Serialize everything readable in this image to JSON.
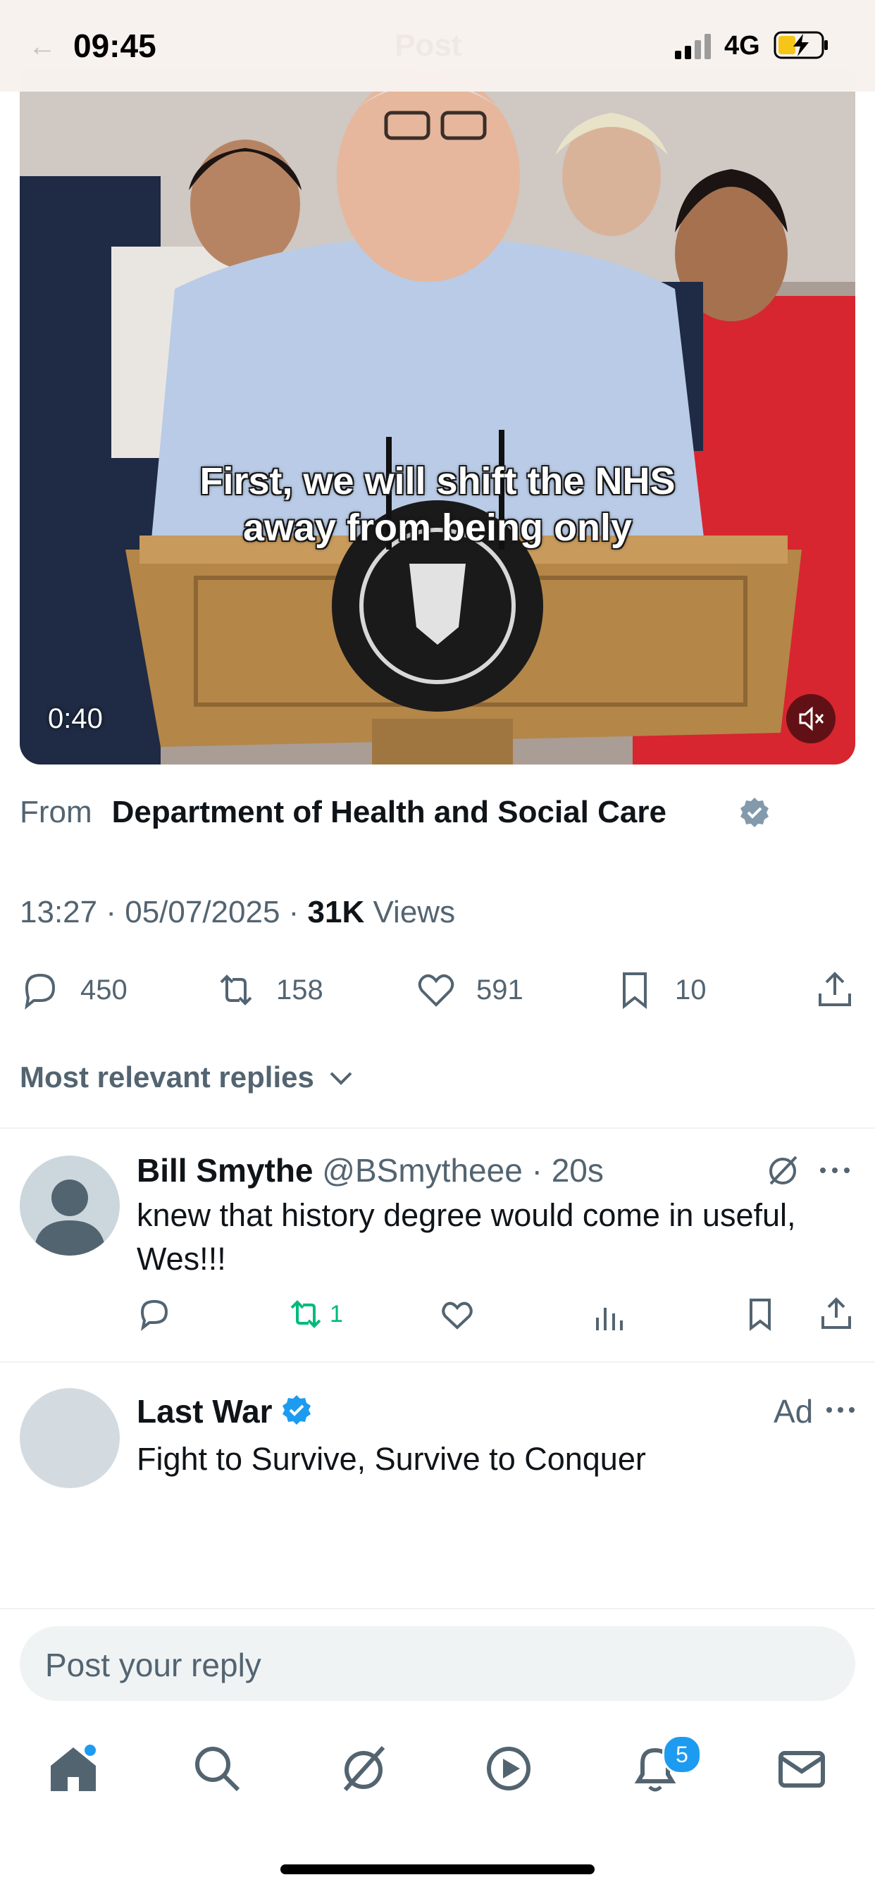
{
  "status_bar": {
    "time": "09:45",
    "network": "4G"
  },
  "header": {
    "title": "Post"
  },
  "video": {
    "caption_line1": "First, we will shift the NHS",
    "caption_line2": "away from being only",
    "duration": "0:40"
  },
  "post": {
    "from_label": "From",
    "from_name": "Department of Health and Social Care",
    "time": "13:27",
    "date": "05/07/2025",
    "views_count": "31K",
    "views_label": "Views",
    "replies": "450",
    "reposts": "158",
    "likes": "591",
    "bookmarks": "10"
  },
  "replies_filter": {
    "label": "Most relevant replies"
  },
  "replies": [
    {
      "name": "Bill Smythe",
      "handle": "@BSmytheee",
      "age": "20s",
      "text_line1": "knew that history degree would come in useful,",
      "text_line2": "Wes!!!",
      "reposts": "1"
    }
  ],
  "ad": {
    "name": "Last War",
    "label": "Ad",
    "text": "Fight to Survive, Survive to Conquer"
  },
  "composer": {
    "placeholder": "Post your reply"
  },
  "tab_bar": {
    "notifications_badge": "5"
  },
  "colors": {
    "accent": "#1d9bf0",
    "secondary_text": "#536471",
    "repost_green": "#00ba7c",
    "divider": "#eff3f4"
  },
  "icons": [
    "reply-icon",
    "repost-icon",
    "like-icon",
    "bookmark-icon",
    "share-icon",
    "grok-icon",
    "more-icon",
    "analytics-icon",
    "home-icon",
    "search-icon",
    "play-icon",
    "bell-icon",
    "mail-icon",
    "mute-icon",
    "verified-badge-icon"
  ]
}
